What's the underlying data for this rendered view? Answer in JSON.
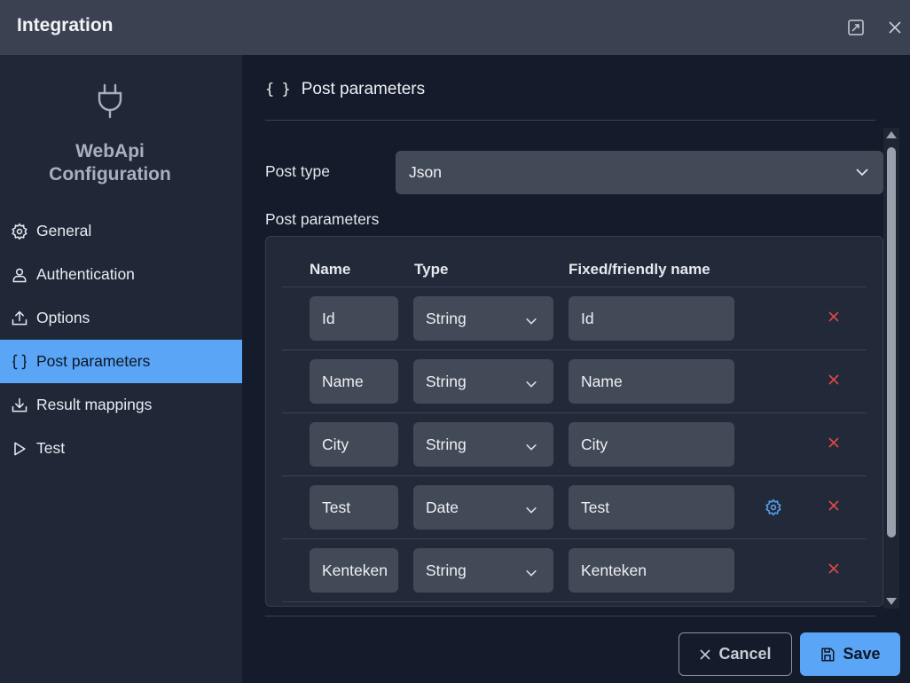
{
  "window": {
    "title": "Integration"
  },
  "sidebar": {
    "app_title_line1": "WebApi",
    "app_title_line2": "Configuration",
    "items": [
      {
        "label": "General",
        "icon": "gear-icon"
      },
      {
        "label": "Authentication",
        "icon": "user-icon"
      },
      {
        "label": "Options",
        "icon": "upload-icon"
      },
      {
        "label": "Post parameters",
        "icon": "braces-icon",
        "active": true
      },
      {
        "label": "Result mappings",
        "icon": "download-icon"
      },
      {
        "label": "Test",
        "icon": "play-icon"
      }
    ]
  },
  "main": {
    "section_icon": "{ }",
    "section_title": "Post parameters",
    "post_type_label": "Post type",
    "post_type_value": "Json",
    "params_label": "Post parameters",
    "columns": {
      "name": "Name",
      "type": "Type",
      "friendly": "Fixed/friendly name"
    },
    "rows": [
      {
        "name": "Id",
        "type": "String",
        "friendly": "Id",
        "has_settings": false
      },
      {
        "name": "Name",
        "type": "String",
        "friendly": "Name",
        "has_settings": false
      },
      {
        "name": "City",
        "type": "String",
        "friendly": "City",
        "has_settings": false
      },
      {
        "name": "Test",
        "type": "Date",
        "friendly": "Test",
        "has_settings": true
      },
      {
        "name": "Kenteken",
        "type": "String",
        "friendly": "Kenteken",
        "has_settings": false
      }
    ]
  },
  "footer": {
    "cancel_label": "Cancel",
    "save_label": "Save"
  },
  "colors": {
    "accent": "#5aa5f5",
    "delete": "#e04848",
    "background": "#141b2a",
    "sidebar": "#202838"
  }
}
